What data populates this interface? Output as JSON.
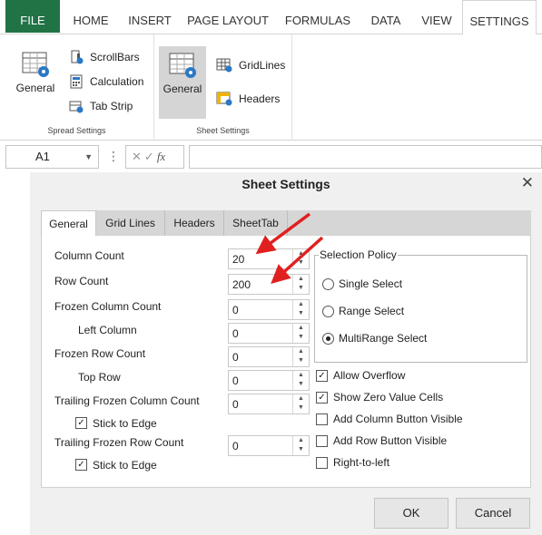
{
  "ribbon": {
    "tabs": [
      {
        "label": "FILE"
      },
      {
        "label": "HOME"
      },
      {
        "label": "INSERT"
      },
      {
        "label": "PAGE LAYOUT"
      },
      {
        "label": "FORMULAS"
      },
      {
        "label": "DATA"
      },
      {
        "label": "VIEW"
      },
      {
        "label": "SETTINGS"
      }
    ],
    "active_tab": "SETTINGS",
    "spread_group": {
      "label": "Spread Settings",
      "general": "General",
      "scrollbars": "ScrollBars",
      "calculation": "Calculation",
      "tabstrip": "Tab Strip"
    },
    "sheet_group": {
      "label": "Sheet Settings",
      "general": "General",
      "gridlines": "GridLines",
      "headers": "Headers"
    }
  },
  "formula_bar": {
    "name_box": "A1",
    "fx": "fx",
    "formula": ""
  },
  "dialog": {
    "title": "Sheet Settings",
    "tabs": [
      {
        "label": "General"
      },
      {
        "label": "Grid Lines"
      },
      {
        "label": "Headers"
      },
      {
        "label": "SheetTab"
      }
    ],
    "fields": {
      "column_count": {
        "label": "Column Count",
        "value": "20"
      },
      "row_count": {
        "label": "Row Count",
        "value": "200"
      },
      "frozen_column_count": {
        "label": "Frozen Column Count",
        "value": "0"
      },
      "left_column": {
        "label": "Left Column",
        "value": "0"
      },
      "frozen_row_count": {
        "label": "Frozen Row Count",
        "value": "0"
      },
      "top_row": {
        "label": "Top Row",
        "value": "0"
      },
      "trailing_frozen_column_count": {
        "label": "Trailing Frozen Column Count",
        "value": "0"
      },
      "stick_to_edge_1": {
        "label": "Stick to Edge",
        "checked": true
      },
      "trailing_frozen_row_count": {
        "label": "Trailing Frozen Row Count",
        "value": "0"
      },
      "stick_to_edge_2": {
        "label": "Stick to Edge",
        "checked": true
      }
    },
    "selection_policy": {
      "legend": "Selection Policy",
      "options": [
        {
          "label": "Single Select",
          "selected": false
        },
        {
          "label": "Range Select",
          "selected": false
        },
        {
          "label": "MultiRange Select",
          "selected": true
        }
      ]
    },
    "options": [
      {
        "label": "Allow Overflow",
        "checked": true
      },
      {
        "label": "Show Zero Value Cells",
        "checked": true
      },
      {
        "label": "Add Column Button Visible",
        "checked": false
      },
      {
        "label": "Add Row Button Visible",
        "checked": false
      },
      {
        "label": "Right-to-left",
        "checked": false
      }
    ],
    "buttons": {
      "ok": "OK",
      "cancel": "Cancel"
    }
  },
  "colors": {
    "file_tab": "#217346",
    "arrow": "#e02020",
    "icon_blue": "#2b78c5"
  }
}
